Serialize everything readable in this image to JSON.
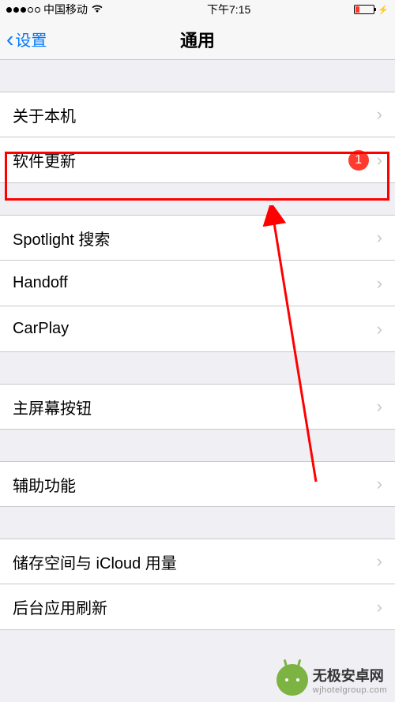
{
  "status": {
    "carrier": "中国移动",
    "time": "下午7:15",
    "charging": "⚡"
  },
  "nav": {
    "back_label": "设置",
    "title": "通用"
  },
  "rows": {
    "about": "关于本机",
    "software_update": "软件更新",
    "software_update_badge": "1",
    "spotlight": "Spotlight 搜索",
    "handoff": "Handoff",
    "carplay": "CarPlay",
    "home_button": "主屏幕按钮",
    "accessibility": "辅助功能",
    "storage": "储存空间与 iCloud 用量",
    "background_refresh": "后台应用刷新"
  },
  "watermark": {
    "title": "无极安卓网",
    "sub": "wjhotelgroup.com"
  },
  "colors": {
    "accent": "#007aff",
    "badge": "#ff3b30",
    "highlight": "#ff0000"
  }
}
